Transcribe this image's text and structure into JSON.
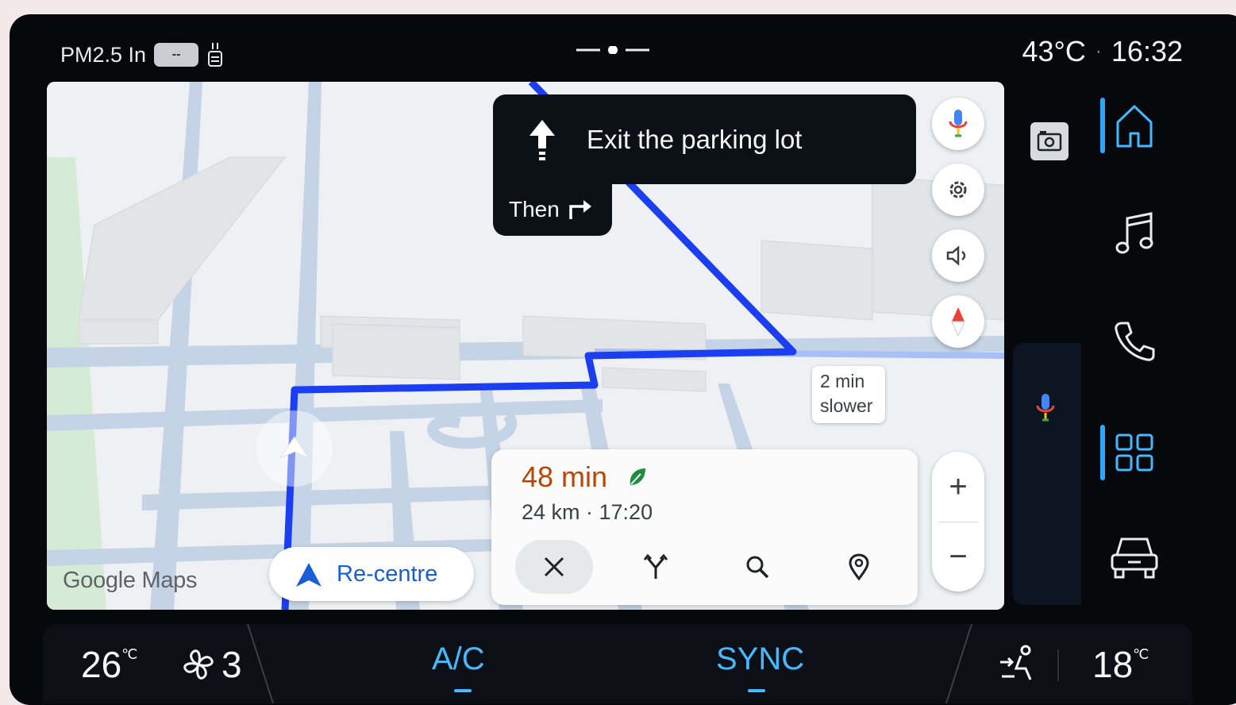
{
  "status_bar": {
    "pm_label": "PM2.5 In",
    "pm_value": "--",
    "temperature": "43°C",
    "separator": "·",
    "time": "16:32"
  },
  "map": {
    "attribution": "Google Maps",
    "direction": {
      "instruction": "Exit the parking lot",
      "then_label": "Then"
    },
    "alt_route_callout": {
      "line1": "2 min",
      "line2": "slower"
    },
    "recentre_label": "Re-centre",
    "trip": {
      "duration": "48 min",
      "distance_eta": "24 km · 17:20"
    },
    "zoom": {
      "in": "+",
      "out": "−"
    },
    "colors": {
      "route": "#1a3ef0",
      "eta": "#b54708",
      "recentre": "#1a5dd8"
    }
  },
  "map_buttons": [
    "mic-icon",
    "gear-icon",
    "volume-icon",
    "compass-icon"
  ],
  "trip_actions": [
    "close-icon",
    "route-options-icon",
    "search-icon",
    "pin-icon"
  ],
  "sidebar": {
    "items": [
      {
        "icon": "home-icon",
        "active": true
      },
      {
        "icon": "music-icon",
        "active": false
      },
      {
        "icon": "phone-icon",
        "active": false
      },
      {
        "icon": "apps-grid-icon",
        "active": true
      },
      {
        "icon": "car-icon",
        "active": false
      }
    ],
    "accent": "#2aa7ff"
  },
  "climate": {
    "driver_temp": "26",
    "passenger_temp": "18",
    "temp_unit": "℃",
    "fan_speed": "3",
    "ac_label": "A/C",
    "sync_label": "SYNC",
    "accent": "#45b9ff"
  }
}
